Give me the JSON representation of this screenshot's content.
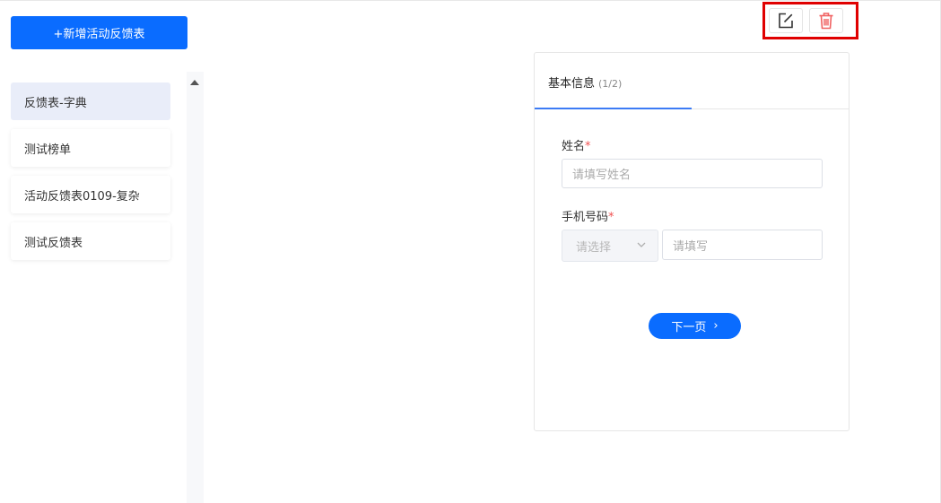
{
  "toolbar": {
    "add_label": "+新增活动反馈表",
    "edit_icon": "edit-icon",
    "delete_icon": "trash-icon"
  },
  "sidebar": {
    "items": [
      {
        "label": "反馈表-字典",
        "active": true
      },
      {
        "label": "测试榜单",
        "active": false
      },
      {
        "label": "活动反馈表0109-复杂",
        "active": false
      },
      {
        "label": "测试反馈表",
        "active": false
      }
    ]
  },
  "form": {
    "tab_title": "基本信息",
    "tab_step": "(1/2)",
    "name_label": "姓名",
    "required_mark": "*",
    "name_placeholder": "请填写姓名",
    "phone_label": "手机号码",
    "select_placeholder": "请选择",
    "phone_placeholder": "请填写",
    "next_label": "下一页",
    "next_arrow": "›"
  },
  "colors": {
    "primary": "#0a6cff",
    "highlight": "#e00000",
    "delete": "#f06060",
    "active_item_bg": "#e9edf9"
  }
}
